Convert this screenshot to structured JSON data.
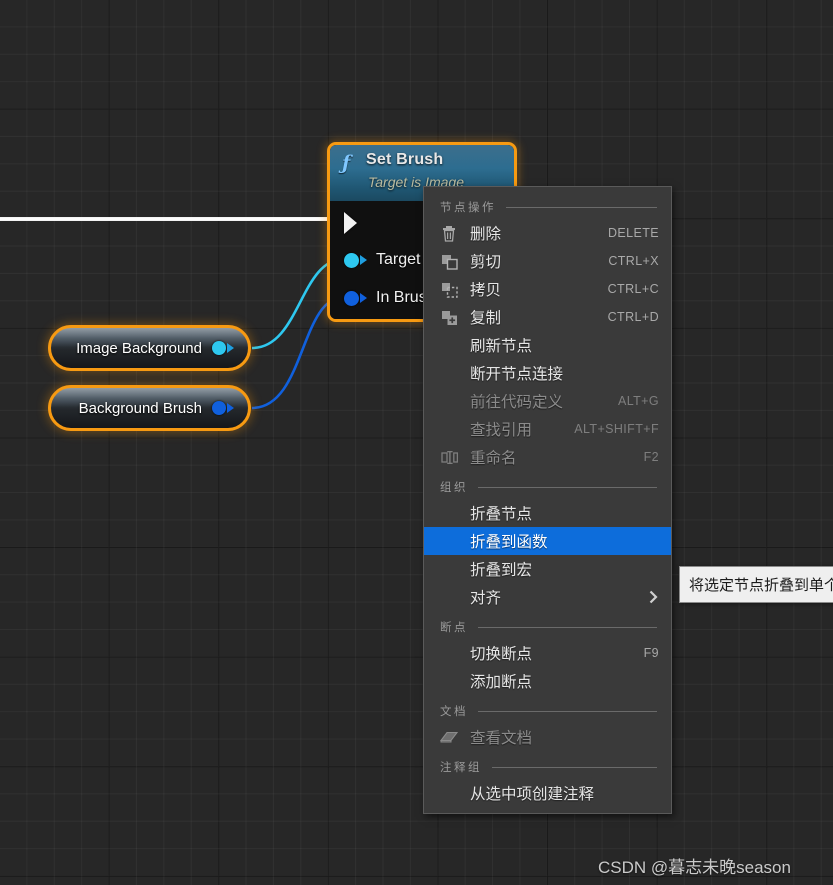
{
  "graph": {
    "nodes": [
      {
        "id": "set-brush",
        "title": "Set Brush",
        "subtitle": "Target is Image",
        "fn_icon": "function-f-icon",
        "pins": [
          {
            "name": "exec-in",
            "label": "",
            "type": "exec",
            "color": "#f2f2f2"
          },
          {
            "name": "target",
            "label": "Target",
            "type": "object",
            "color": "#2ec8f0"
          },
          {
            "name": "in-brush",
            "label": "In Brus",
            "type": "struct",
            "color": "#1060dd"
          }
        ]
      },
      {
        "id": "image-background",
        "label": "Image Background",
        "pin_color": "#2ec8f0"
      },
      {
        "id": "background-brush",
        "label": "Background Brush",
        "pin_color": "#1060dd"
      }
    ],
    "wire_colors": {
      "exec": "#f5f5f5",
      "object": "#2ec8f0",
      "struct": "#1060dd"
    },
    "node_selection_color": "#f79a12"
  },
  "context_menu": {
    "highlight_color": "#0d6ddb",
    "sections": [
      {
        "name": "node-actions",
        "title": "节点操作",
        "items": [
          {
            "name": "delete",
            "label": "删除",
            "shortcut": "DELETE",
            "icon": "trash-icon",
            "disabled": false,
            "selected": false,
            "submenu": false
          },
          {
            "name": "cut",
            "label": "剪切",
            "shortcut": "CTRL+X",
            "icon": "cut-icon",
            "disabled": false,
            "selected": false,
            "submenu": false
          },
          {
            "name": "copy",
            "label": "拷贝",
            "shortcut": "CTRL+C",
            "icon": "copy-icon",
            "disabled": false,
            "selected": false,
            "submenu": false
          },
          {
            "name": "duplicate",
            "label": "复制",
            "shortcut": "CTRL+D",
            "icon": "duplicate-icon",
            "disabled": false,
            "selected": false,
            "submenu": false
          },
          {
            "name": "refresh-node",
            "label": "刷新节点",
            "shortcut": "",
            "icon": "",
            "disabled": false,
            "selected": false,
            "submenu": false
          },
          {
            "name": "break-node-links",
            "label": "断开节点连接",
            "shortcut": "",
            "icon": "",
            "disabled": false,
            "selected": false,
            "submenu": false
          },
          {
            "name": "goto-code-def",
            "label": "前往代码定义",
            "shortcut": "ALT+G",
            "icon": "",
            "disabled": true,
            "selected": false,
            "submenu": false
          },
          {
            "name": "find-references",
            "label": "查找引用",
            "shortcut": "ALT+SHIFT+F",
            "icon": "",
            "disabled": true,
            "selected": false,
            "submenu": false
          },
          {
            "name": "rename",
            "label": "重命名",
            "shortcut": "F2",
            "icon": "rename-icon",
            "disabled": true,
            "selected": false,
            "submenu": false
          }
        ]
      },
      {
        "name": "organization",
        "title": "组织",
        "items": [
          {
            "name": "collapse-nodes",
            "label": "折叠节点",
            "shortcut": "",
            "icon": "",
            "disabled": false,
            "selected": false,
            "submenu": false
          },
          {
            "name": "collapse-to-function",
            "label": "折叠到函数",
            "shortcut": "",
            "icon": "",
            "disabled": false,
            "selected": true,
            "submenu": false
          },
          {
            "name": "collapse-to-macro",
            "label": "折叠到宏",
            "shortcut": "",
            "icon": "",
            "disabled": false,
            "selected": false,
            "submenu": false
          },
          {
            "name": "alignment",
            "label": "对齐",
            "shortcut": "",
            "icon": "",
            "disabled": false,
            "selected": false,
            "submenu": true
          }
        ]
      },
      {
        "name": "breakpoints",
        "title": "断点",
        "items": [
          {
            "name": "toggle-breakpoint",
            "label": "切换断点",
            "shortcut": "F9",
            "icon": "",
            "disabled": false,
            "selected": false,
            "submenu": false
          },
          {
            "name": "add-breakpoint",
            "label": "添加断点",
            "shortcut": "",
            "icon": "",
            "disabled": false,
            "selected": false,
            "submenu": false
          }
        ]
      },
      {
        "name": "documentation",
        "title": "文档",
        "items": [
          {
            "name": "view-documentation",
            "label": "查看文档",
            "shortcut": "",
            "icon": "book-icon",
            "disabled": true,
            "selected": false,
            "submenu": false
          }
        ]
      },
      {
        "name": "comment-group",
        "title": "注释组",
        "items": [
          {
            "name": "create-comment-from-selection",
            "label": "从选中项创建注释",
            "shortcut": "",
            "icon": "",
            "disabled": false,
            "selected": false,
            "submenu": false
          }
        ]
      }
    ]
  },
  "tooltip": {
    "text": "将选定节点折叠到单个"
  },
  "watermark": {
    "text": "CSDN @暮志未晚season"
  }
}
